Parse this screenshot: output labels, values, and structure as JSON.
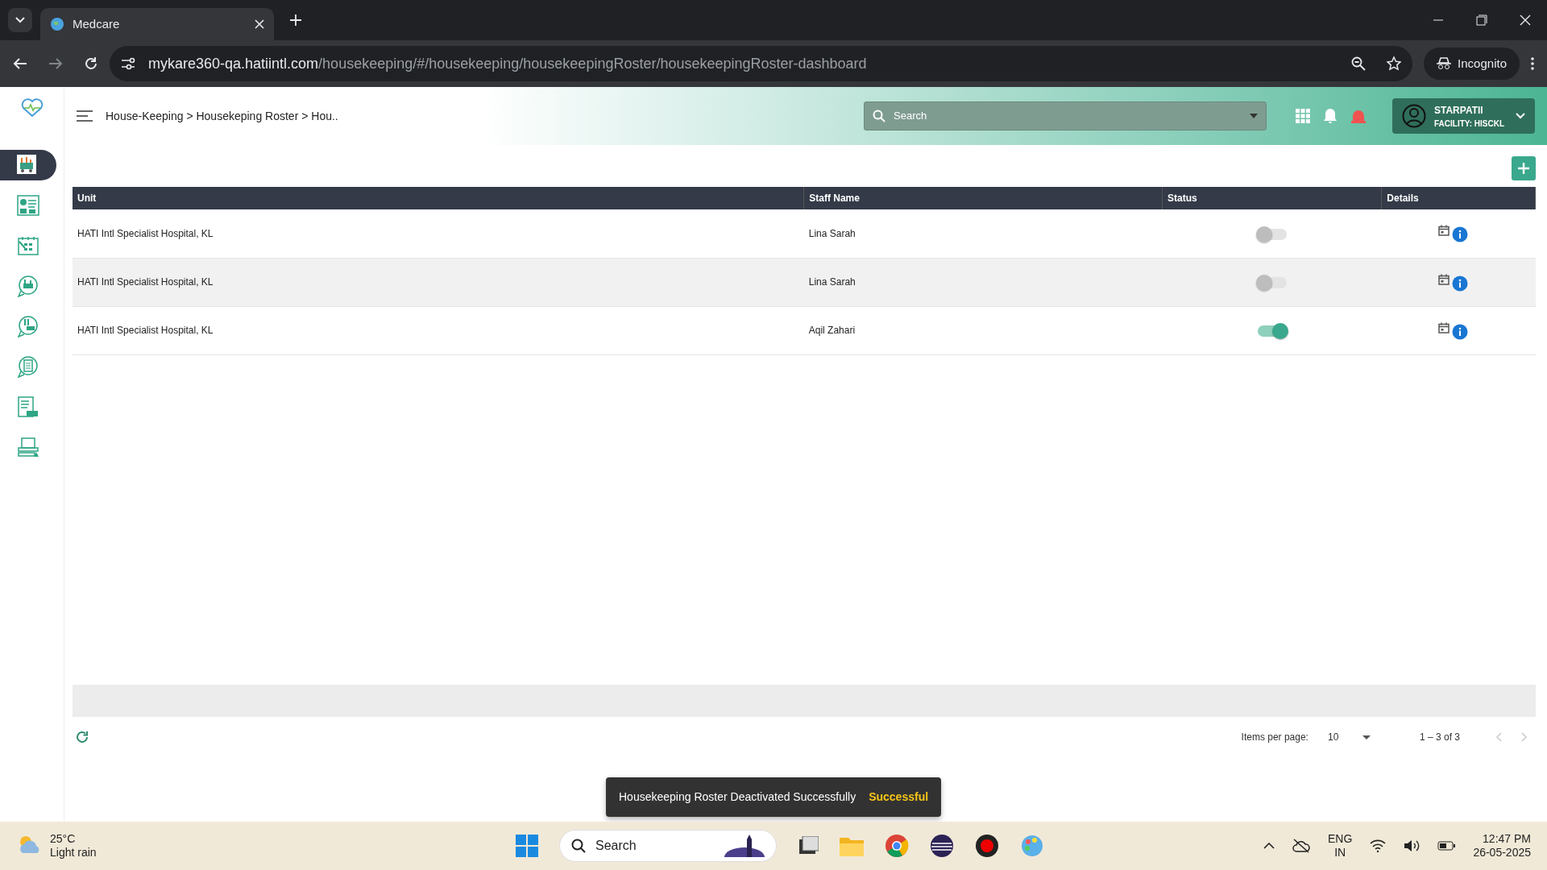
{
  "browser": {
    "tab_title": "Medcare",
    "url_host": "mykare360-qa.hatiintl.com",
    "url_path": "/housekeeping/#/housekeeping/housekeepingRoster/housekeepingRoster-dashboard",
    "incognito_label": "Incognito"
  },
  "sidebar": {
    "items": [
      {
        "selected": true
      },
      {
        "selected": false
      },
      {
        "selected": false
      },
      {
        "selected": false
      },
      {
        "selected": false
      },
      {
        "selected": false
      },
      {
        "selected": false
      },
      {
        "selected": false
      }
    ]
  },
  "header": {
    "breadcrumb": "House-Keeping > Housekeping Roster > Hou..",
    "search": {
      "placeholder": "Search"
    },
    "user": {
      "name": "STARPATIl",
      "facility": "FACILITY: HISCKL"
    }
  },
  "table": {
    "columns": [
      "Unit",
      "Staff Name",
      "Status",
      "Details"
    ],
    "rows": [
      {
        "unit": "HATI Intl Specialist Hospital, KL",
        "staff": "Lina Sarah",
        "on": false
      },
      {
        "unit": "HATI Intl Specialist Hospital, KL",
        "staff": "Lina Sarah",
        "on": false
      },
      {
        "unit": "HATI Intl Specialist Hospital, KL",
        "staff": "Aqil Zahari",
        "on": true
      }
    ]
  },
  "paginator": {
    "items_per_page_label": "Items per page:",
    "page_size": "10",
    "range": "1 – 3 of 3"
  },
  "toast": {
    "message": "Housekeeping Roster Deactivated Successfully",
    "action": "Successful"
  },
  "taskbar": {
    "temperature": "25°C",
    "weather": "Light rain",
    "search": "Search",
    "language": "ENG",
    "region": "IN",
    "time": "12:47 PM",
    "date": "26-05-2025"
  }
}
